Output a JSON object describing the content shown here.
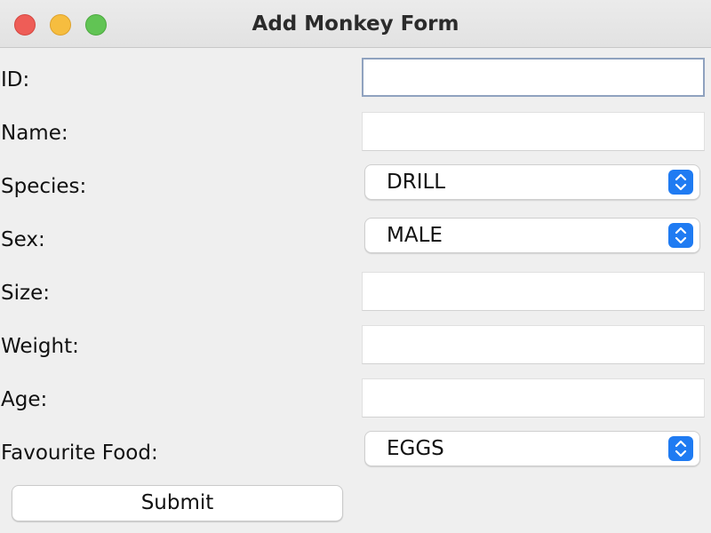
{
  "window": {
    "title": "Add Monkey Form"
  },
  "form": {
    "id_label": "ID:",
    "id_value": "",
    "name_label": "Name:",
    "name_value": "",
    "species_label": "Species:",
    "species_value": "DRILL",
    "sex_label": "Sex:",
    "sex_value": "MALE",
    "size_label": "Size:",
    "size_value": "",
    "weight_label": "Weight:",
    "weight_value": "",
    "age_label": "Age:",
    "age_value": "",
    "food_label": "Favourite Food:",
    "food_value": "EGGS",
    "submit_label": "Submit"
  },
  "icons": {
    "close": "close-traffic-light",
    "minimize": "minimize-traffic-light",
    "maximize": "maximize-traffic-light",
    "select_arrows": "up-down-chevron-icon"
  },
  "colors": {
    "accent": "#1f7bf2",
    "close": "#ee5d57",
    "minimize": "#f6bd3f",
    "maximize": "#61c454",
    "focus_ring": "#8fa2bf"
  }
}
